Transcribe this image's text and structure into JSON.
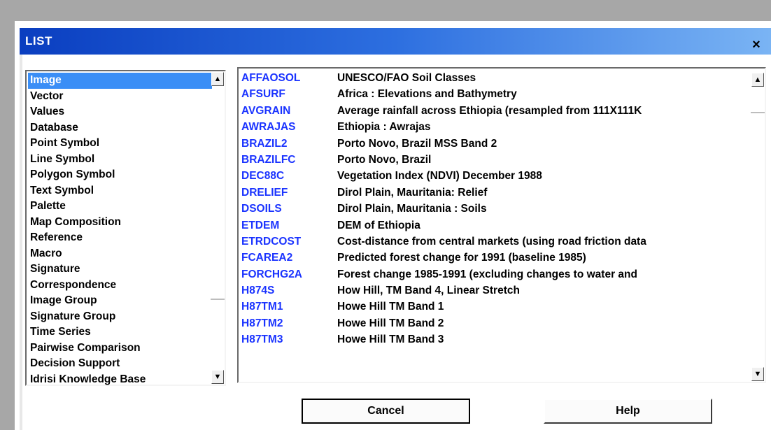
{
  "window": {
    "title": "LIST",
    "close_label": "×"
  },
  "type_list": {
    "items": [
      "Image",
      "Vector",
      "Values",
      "Database",
      "Point Symbol",
      "Line Symbol",
      "Polygon Symbol",
      "Text Symbol",
      "Palette",
      "Map Composition",
      "Reference",
      "Macro",
      "Signature",
      "Correspondence",
      "Image Group",
      "Signature Group",
      "Time Series",
      "Pairwise Comparison",
      "Decision Support",
      "Idrisi Knowledge Base"
    ],
    "selected_index": 0
  },
  "file_list": {
    "rows": [
      {
        "name": "AFFAOSOL",
        "desc": "UNESCO/FAO Soil Classes"
      },
      {
        "name": "AFSURF",
        "desc": "Africa : Elevations and Bathymetry"
      },
      {
        "name": "AVGRAIN",
        "desc": "Average rainfall across Ethiopia (resampled from 111X111K"
      },
      {
        "name": "AWRAJAS",
        "desc": "Ethiopia : Awrajas"
      },
      {
        "name": "BRAZIL2",
        "desc": "Porto Novo, Brazil MSS Band 2"
      },
      {
        "name": "BRAZILFC",
        "desc": "Porto Novo, Brazil"
      },
      {
        "name": "DEC88C",
        "desc": "Vegetation Index (NDVI) December 1988"
      },
      {
        "name": "DRELIEF",
        "desc": "Dirol Plain, Mauritania: Relief"
      },
      {
        "name": "DSOILS",
        "desc": "Dirol Plain, Mauritania : Soils"
      },
      {
        "name": "ETDEM",
        "desc": "DEM of Ethiopia"
      },
      {
        "name": "ETRDCOST",
        "desc": "Cost-distance from central markets (using road friction data"
      },
      {
        "name": "FCAREA2",
        "desc": "Predicted forest change for 1991 (baseline 1985)"
      },
      {
        "name": "FORCHG2A",
        "desc": "Forest change 1985-1991 (excluding changes to water and"
      },
      {
        "name": "H874S",
        "desc": "How Hill, TM Band 4, Linear Stretch"
      },
      {
        "name": "H87TM1",
        "desc": "Howe Hill TM Band 1"
      },
      {
        "name": "H87TM2",
        "desc": "Howe Hill TM Band 2"
      },
      {
        "name": "H87TM3",
        "desc": "Howe Hill TM Band 3"
      }
    ]
  },
  "buttons": {
    "cancel": "Cancel",
    "help": "Help"
  },
  "icons": {
    "scroll_up": "▲",
    "scroll_down": "▼"
  },
  "colors": {
    "title_gradient_start": "#0a3ec0",
    "title_gradient_end": "#7ab4f4",
    "selection": "#3a8ef6",
    "file_name": "#1a33ff"
  }
}
